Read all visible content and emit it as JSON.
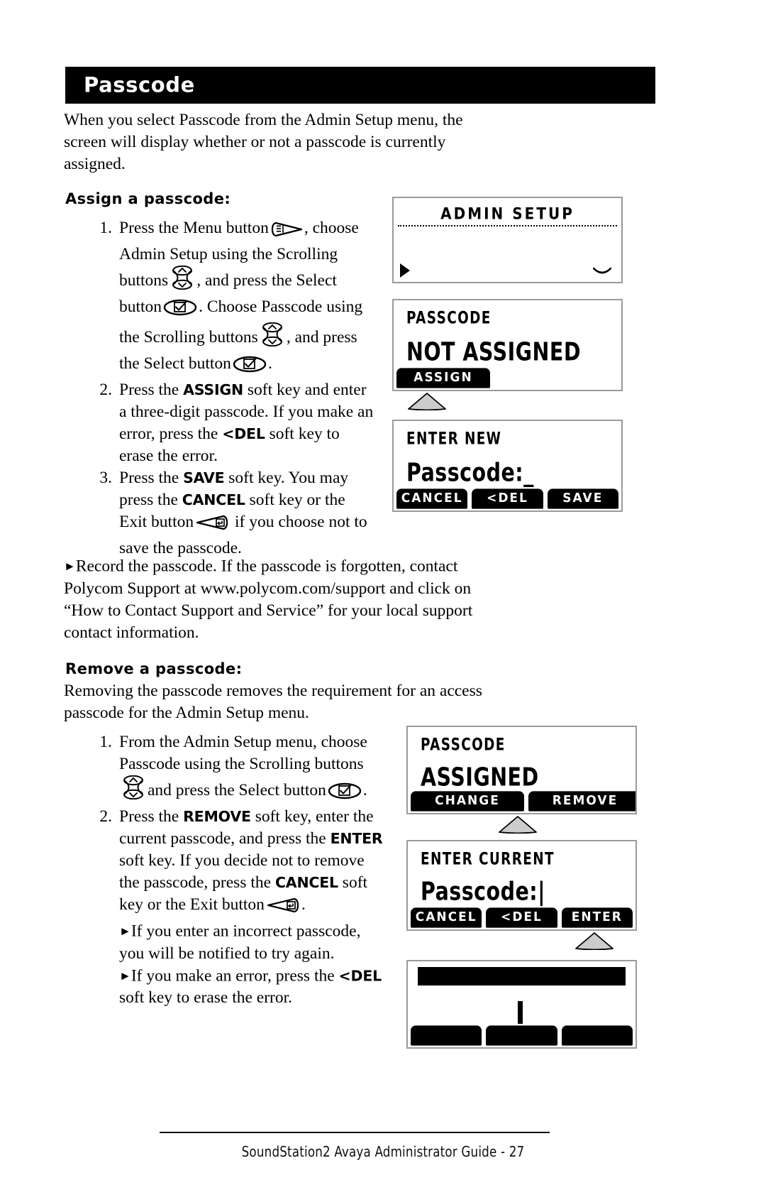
{
  "page": {
    "title": "Passcode",
    "intro": "When you select Passcode from the Admin Setup menu, the screen will display whether or not a passcode is currently assigned.",
    "footer": "SoundStation2 Avaya Administrator Guide - 27"
  },
  "assign": {
    "heading": "Assign a passcode:",
    "steps": [
      {
        "num": "1.",
        "a": "Press the Menu button",
        "b": ", choose Admin Setup using the Scrolling buttons",
        "c": ", and press the Select button",
        "d": ".  Choose Passcode using the Scrolling buttons",
        "e": ", and press the Select button",
        "f": "."
      },
      {
        "num": "2.",
        "a": "Press the",
        "key1": "ASSIGN",
        "b": "soft key and enter a three-digit passcode.  If you make an error, press the",
        "key2": "<DEL",
        "c": "soft key to erase the error."
      },
      {
        "num": "3.",
        "a": "Press the",
        "key1": "SAVE",
        "b": "soft key.  You may press the",
        "key2": "CANCEL",
        "c": "soft key or the Exit button",
        "d": "if you choose not to save the passcode."
      }
    ],
    "record_note": {
      "marker": "►",
      "text": "Record the passcode.  If the passcode is forgotten, contact Polycom Support at www.polycom.com/support and click on “How to Contact Support and Service” for your local support contact information."
    }
  },
  "remove": {
    "heading": "Remove a passcode:",
    "intro": "Removing the passcode removes the requirement for an access passcode for the Admin Setup menu.",
    "steps": [
      {
        "num": "1.",
        "a": "From the Admin Setup menu, choose Passcode using the Scrolling buttons",
        "b": "and press the Select button",
        "c": "."
      },
      {
        "num": "2.",
        "a": "Press the",
        "key1": "REMOVE",
        "b": "soft key, enter the current passcode, and press the",
        "key2": "ENTER",
        "c": "soft key.  If you decide not to remove the passcode, press the",
        "key3": "CANCEL",
        "d": "soft key or the Exit button",
        "e": ".",
        "note1_marker": "►",
        "note1": "If you enter an incorrect passcode, you will be notified to try again.",
        "note2_marker": "►",
        "note2_a": "If you make an error, press the",
        "note2_key": "<DEL",
        "note2_b": "soft key to erase the error."
      }
    ]
  },
  "screens": {
    "admin_setup": {
      "title": "ADMIN SETUP",
      "marker_icon": "right-caret-icon",
      "scroll_icon": "chevron-down-icon"
    },
    "passcode_not_assigned": {
      "title": "PASSCODE",
      "value": "NOT ASSIGNED",
      "softkeys": [
        "ASSIGN"
      ]
    },
    "enter_new": {
      "title": "ENTER NEW",
      "value": "Passcode:_",
      "softkeys": [
        "CANCEL",
        "<DEL",
        "SAVE"
      ]
    },
    "passcode_assigned": {
      "title": "PASSCODE",
      "value": "ASSIGNED",
      "softkeys": [
        "CHANGE",
        "REMOVE"
      ]
    },
    "enter_current": {
      "title": "ENTER CURRENT",
      "value": "Passcode:|",
      "softkeys": [
        "CANCEL",
        "<DEL",
        "ENTER"
      ]
    },
    "blank_screen": {
      "title": "",
      "value": "",
      "softkeys": [
        "",
        "",
        ""
      ]
    }
  },
  "colors": {
    "ink": "#000000",
    "paper": "#ffffff",
    "lcd_border": "#9a9a9a",
    "connector_fill": "#cccccc"
  }
}
